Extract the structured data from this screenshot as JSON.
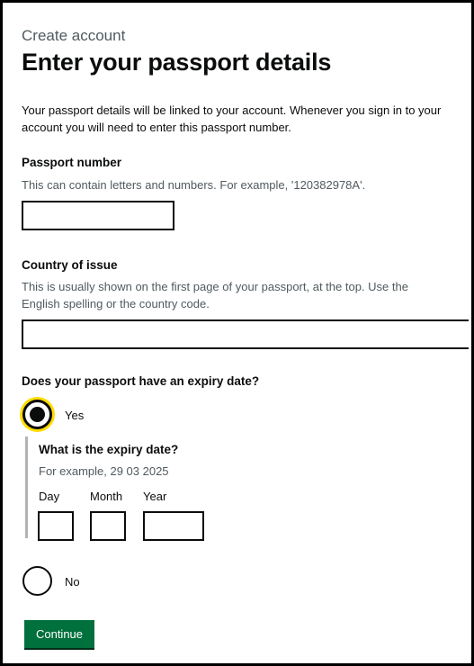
{
  "header": {
    "caption": "Create account",
    "title": "Enter your passport details"
  },
  "intro": "Your passport details will be linked to your account. Whenever you sign in to your account you will need to enter this passport number.",
  "passport_number": {
    "label": "Passport number",
    "hint": "This can contain letters and numbers. For example, '120382978A'.",
    "value": ""
  },
  "country_of_issue": {
    "label": "Country of issue",
    "hint": "This is usually shown on the first page of your passport, at the top. Use the English spelling or the country code.",
    "value": ""
  },
  "expiry_question": {
    "label": "Does your passport have an expiry date?",
    "options": [
      {
        "label": "Yes",
        "selected": true
      },
      {
        "label": "No",
        "selected": false
      }
    ]
  },
  "expiry_date": {
    "label": "What is the expiry date?",
    "hint": "For example, 29 03 2025",
    "day_label": "Day",
    "month_label": "Month",
    "year_label": "Year"
  },
  "actions": {
    "continue_label": "Continue"
  },
  "colors": {
    "button": "#00703c",
    "focus": "#ffdd00",
    "text": "#0b0c0c",
    "hint": "#505a5f"
  }
}
